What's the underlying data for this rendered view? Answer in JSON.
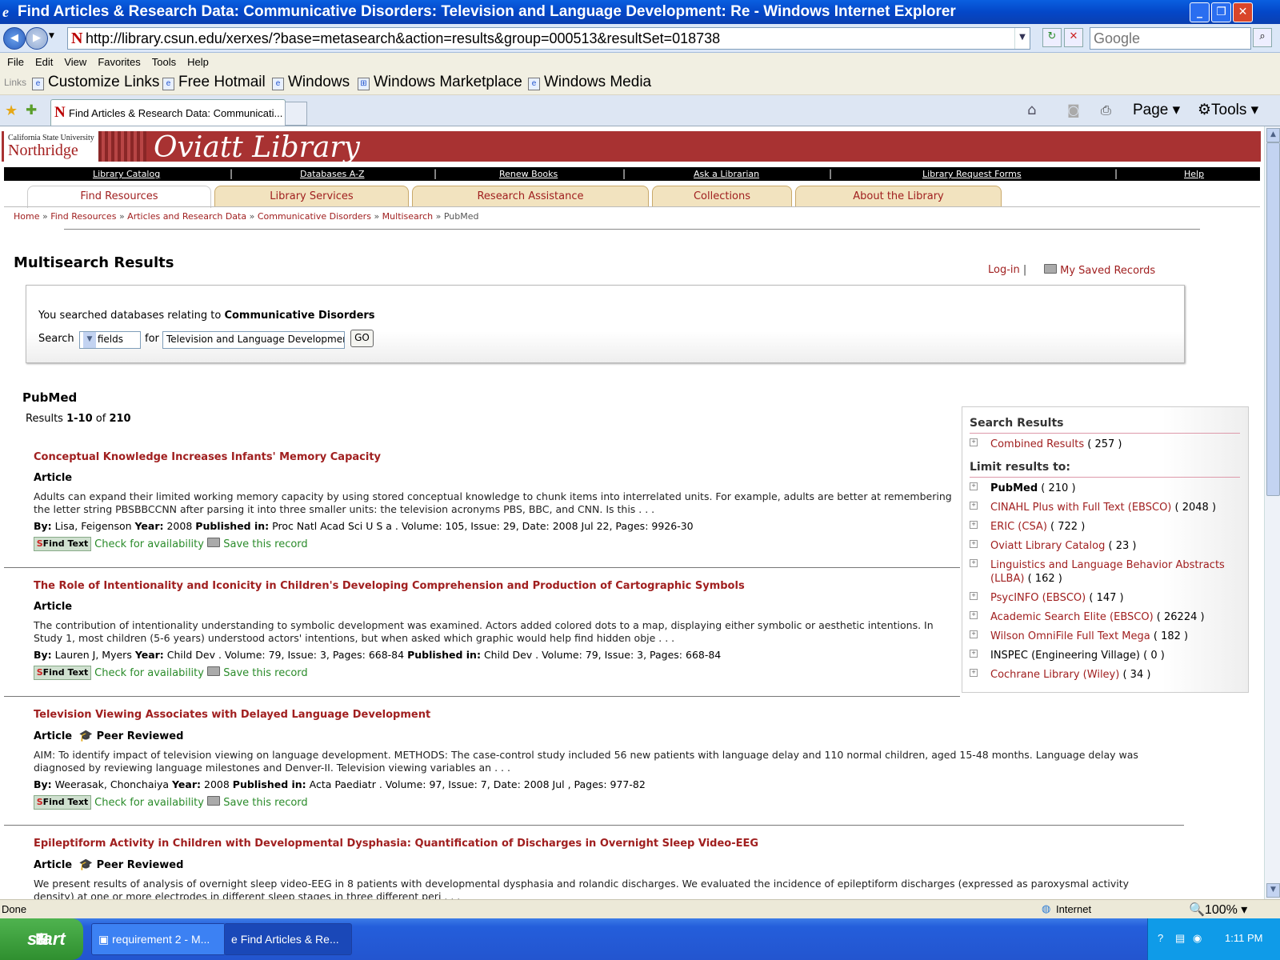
{
  "window": {
    "title": "Find Articles & Research Data: Communicative Disorders: Television and Language Development: Re - Windows Internet Explorer",
    "url": "http://library.csun.edu/xerxes/?base=metasearch&action=results&group=000513&resultSet=018738",
    "search_placeholder": "Google",
    "tab_title": "Find Articles & Research Data: Communicati...",
    "page_menu": "Page",
    "tools_menu": "Tools"
  },
  "menu": [
    "File",
    "Edit",
    "View",
    "Favorites",
    "Tools",
    "Help"
  ],
  "links_bar": {
    "label": "Links",
    "items": [
      "Customize Links",
      "Free Hotmail",
      "Windows",
      "Windows Marketplace",
      "Windows Media"
    ]
  },
  "header": {
    "university_line1": "California State University",
    "university_line2": "Northridge",
    "brand": "Oviatt Library"
  },
  "top_nav": [
    "Library Catalog",
    "Databases A-Z",
    "Renew Books",
    "Ask a Librarian",
    "Library Request Forms",
    "Help"
  ],
  "main_tabs": [
    "Find Resources",
    "Library Services",
    "Research Assistance",
    "Collections",
    "About the Library"
  ],
  "breadcrumb": {
    "links": [
      "Home",
      "Find Resources",
      "Articles and Research Data",
      "Communicative Disorders",
      "Multisearch"
    ],
    "current": "PubMed",
    "separator": "»"
  },
  "page_title": "Multisearch Results",
  "account": {
    "login": "Log-in",
    "saved": "My Saved Records",
    "separator": "|"
  },
  "search": {
    "prefix": "You searched databases relating to",
    "subject": "Communicative Disorders",
    "search_label": "Search",
    "field_value": "all fields",
    "for_label": "for",
    "term": "Television and Language Development",
    "go_label": "GO"
  },
  "results": {
    "database": "PubMed",
    "summary_prefix": "Results",
    "range": "1-10",
    "of_label": "of",
    "total": "210",
    "labels": {
      "by": "By:",
      "year": "Year:",
      "published": "Published in:",
      "find_text": "Find Text",
      "check": "Check for availability",
      "save": "Save this record",
      "peer": "Peer Reviewed"
    },
    "items": [
      {
        "title": "Conceptual Knowledge Increases Infants' Memory Capacity",
        "type": "Article",
        "abstract": "Adults can expand their limited working memory capacity by using stored conceptual knowledge to chunk items into interrelated units. For example, adults are better at remembering the letter string PBSBBCCNN after parsing it into three smaller units: the television acronyms PBS, BBC, and CNN. Is this . . .",
        "author": "Lisa, Feigenson",
        "year": "2008",
        "published": "Proc Natl Acad Sci U S a . Volume: 105, Issue: 29, Date: 2008 Jul 22, Pages: 9926-30"
      },
      {
        "title": "The Role of Intentionality and Iconicity in Children's Developing Comprehension and Production of Cartographic Symbols",
        "type": "Article",
        "abstract": "The contribution of intentionality understanding to symbolic development was examined. Actors added colored dots to a map, displaying either symbolic or aesthetic intentions. In Study 1, most children (5-6 years) understood actors' intentions, but when asked which graphic would help find hidden obje . . .",
        "author": "Lauren J, Myers",
        "year": "Child Dev . Volume: 79, Issue: 3, Pages: 668-84",
        "published": "Child Dev . Volume: 79, Issue: 3, Pages: 668-84"
      },
      {
        "title": "Television Viewing Associates with Delayed Language Development",
        "type": "Article",
        "abstract": "AIM: To identify impact of television viewing on language development. METHODS: The case-control study included 56 new patients with language delay and 110 normal children, aged 15-48 months. Language delay was diagnosed by reviewing language milestones and Denver-II. Television viewing variables an . . .",
        "author": "Weerasak, Chonchaiya",
        "year": "2008",
        "published": "Acta Paediatr . Volume: 97, Issue: 7, Date: 2008 Jul , Pages: 977-82"
      },
      {
        "title": "Epileptiform Activity in Children with Developmental Dysphasia: Quantification of Discharges in Overnight Sleep Video-EEG",
        "type": "Article",
        "abstract": "We present results of analysis of overnight sleep video-EEG in 8 patients with developmental dysphasia and rolandic discharges. We evaluated the incidence of epileptiform discharges (expressed as paroxysmal activity density) at one or more electrodes in different sleep stages in three different peri . . ."
      }
    ]
  },
  "sidebar": {
    "search_results_heading": "Search Results",
    "combined": {
      "label": "Combined Results",
      "count": "( 257 )"
    },
    "limit_heading": "Limit results to:",
    "databases": [
      {
        "name": "PubMed",
        "count": "( 210 )"
      },
      {
        "name": "CINAHL Plus with Full Text (EBSCO)",
        "count": "( 2048 )"
      },
      {
        "name": "ERIC (CSA)",
        "count": "( 722 )"
      },
      {
        "name": "Oviatt Library Catalog",
        "count": "( 23 )"
      },
      {
        "name": "Linguistics and Language Behavior Abstracts (LLBA)",
        "count": "( 162 )"
      },
      {
        "name": "PsycINFO (EBSCO)",
        "count": "( 147 )"
      },
      {
        "name": "Academic Search Elite (EBSCO)",
        "count": "( 26224 )"
      },
      {
        "name": "Wilson OmniFile Full Text Mega",
        "count": "( 182 )"
      },
      {
        "name": "INSPEC (Engineering Village)",
        "count": "( 0 )"
      },
      {
        "name": "Cochrane Library (Wiley)",
        "count": "( 34 )"
      }
    ]
  },
  "status": {
    "text": "Done",
    "zone": "Internet",
    "zoom": "100%"
  },
  "taskbar": {
    "start": "start",
    "tasks": [
      "requirement 2 - M...",
      "Find Articles & Re..."
    ],
    "clock": "1:11 PM"
  },
  "icons": [
    "ie-icon",
    "back-icon",
    "forward-icon",
    "refresh-icon",
    "stop-icon",
    "home-icon",
    "feeds-icon",
    "print-icon",
    "favorites-star-icon",
    "add-favorites-icon",
    "folder-icon",
    "mortarboard-icon",
    "globe-icon",
    "windows-logo-icon"
  ],
  "colors": {
    "library_red": "#a83232",
    "link_red": "#a01f1f",
    "check_green": "#2a8b2a",
    "xp_blue": "#245edb",
    "tab_tan": "#f2e3bf"
  }
}
